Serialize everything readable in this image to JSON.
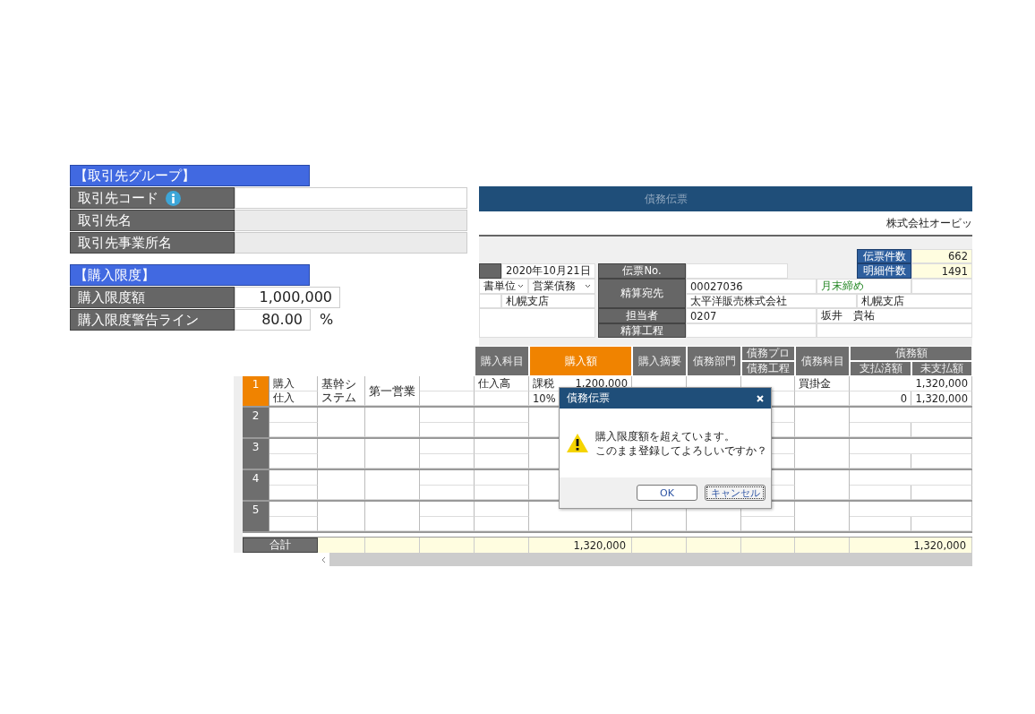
{
  "partner_group": {
    "title": "【取引先グループ】",
    "fields": [
      {
        "label": "取引先コード",
        "info": true,
        "kind": "input"
      },
      {
        "label": "取引先名",
        "info": false,
        "kind": "readonly"
      },
      {
        "label": "取引先事業所名",
        "info": false,
        "kind": "readonly"
      }
    ]
  },
  "purchase_limit": {
    "title": "【購入限度】",
    "fields": [
      {
        "label": "購入限度額",
        "value": "1,000,000"
      },
      {
        "label": "購入限度警告ライン",
        "value": "80.00",
        "unit": "%"
      }
    ]
  },
  "voucher": {
    "title": "債務伝票",
    "company": "株式会社オービッ",
    "counts": [
      {
        "label": "伝票件数",
        "value": "662"
      },
      {
        "label": "明細件数",
        "value": "1491"
      }
    ],
    "form": {
      "date": "2020年10月21日",
      "voucher_no_label": "伝票No.",
      "unit_select": "書単位",
      "debt_select": "営業債務",
      "branch": "札幌支店",
      "settlement_label": "精算宛先",
      "settlement_code": "00027036",
      "closing": "月末締め",
      "settlement_name": "太平洋販売株式会社",
      "settlement_branch": "札幌支店",
      "staff_label": "担当者",
      "staff_code": "0207",
      "staff_name": "坂井　貴祐",
      "process_label": "精算工程"
    }
  },
  "grid": {
    "header": [
      {
        "kind": "single",
        "label": "購入科目",
        "selected": false
      },
      {
        "kind": "single",
        "label": "購入額",
        "selected": true
      },
      {
        "kind": "single",
        "label": "購入摘要",
        "selected": false
      },
      {
        "kind": "single",
        "label": "債務部門",
        "selected": false
      },
      {
        "kind": "stacked",
        "top": "債務プロ",
        "bottom": "債務工程"
      },
      {
        "kind": "single",
        "label": "債務科目",
        "selected": false
      },
      {
        "kind": "group",
        "label": "債務額",
        "children": [
          "支払済額",
          "未支払額"
        ]
      }
    ],
    "rows": [
      {
        "number": "1",
        "selected": true,
        "cells": [
          {
            "kind": "split",
            "top": "購入",
            "bottom": "仕入"
          },
          {
            "kind": "text",
            "text": "基幹システム"
          },
          {
            "kind": "text",
            "text": "第一営業"
          },
          null,
          {
            "kind": "split",
            "top": "仕入高"
          },
          {
            "kind": "amount",
            "tax": "課税",
            "amount": "1,200,000",
            "rate": "10%"
          },
          null,
          null,
          null,
          {
            "kind": "split",
            "top": "買掛金"
          },
          {
            "kind": "balance",
            "total": "1,320,000",
            "paid": "0",
            "unpaid": "1,320,000"
          }
        ]
      },
      {
        "number": "2",
        "selected": false
      },
      {
        "number": "3",
        "selected": false
      },
      {
        "number": "4",
        "selected": false
      },
      {
        "number": "5",
        "selected": false
      }
    ],
    "totals": {
      "label": "合計",
      "amount": "1,320,000",
      "unpaid": "1,320,000"
    }
  },
  "dialog": {
    "title": "債務伝票",
    "message": [
      "購入限度額を超えています。",
      "このまま登録してよろしいですか？"
    ],
    "buttons": [
      {
        "label": "OK",
        "focused": false
      },
      {
        "label": "キャンセル",
        "focused": true
      }
    ]
  }
}
